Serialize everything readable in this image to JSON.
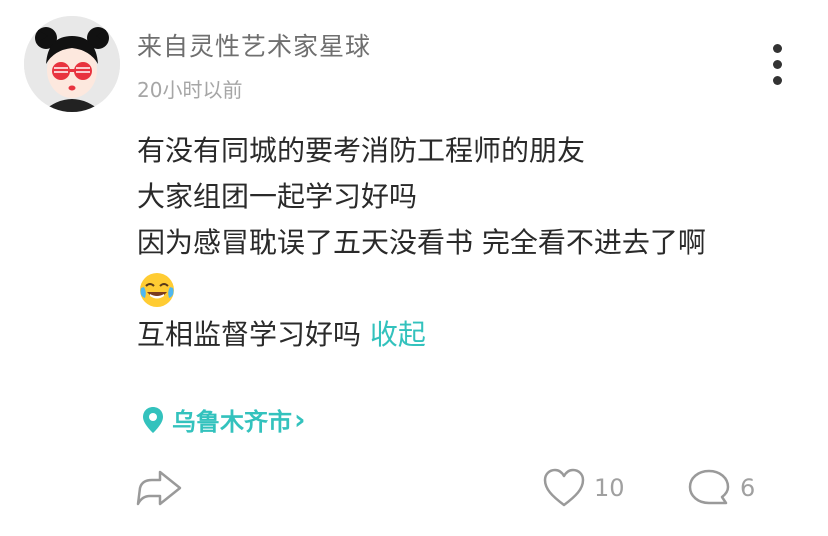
{
  "post": {
    "author": "来自灵性艺术家星球",
    "time": "20小时以前",
    "lines": [
      "有没有同城的要考消防工程师的朋友",
      "大家组团一起学习好吗",
      "因为感冒耽误了五天没看书 完全看不进去了啊"
    ],
    "last_line": "互相监督学习好吗",
    "collapse_label": "收起",
    "emoji": "crying-laughing-emoji"
  },
  "location": {
    "label": "乌鲁木齐市",
    "chevron": "›"
  },
  "actions": {
    "like_count": "10",
    "comment_count": "6"
  },
  "icons": {
    "share": "share-arrow-icon",
    "like": "heart-icon",
    "comment": "chat-bubble-icon",
    "more": "vertical-dots-icon",
    "location": "location-pin-icon"
  },
  "colors": {
    "accent": "#33c2bd",
    "muted": "#a0a0a0",
    "text": "#2a2a2a"
  }
}
